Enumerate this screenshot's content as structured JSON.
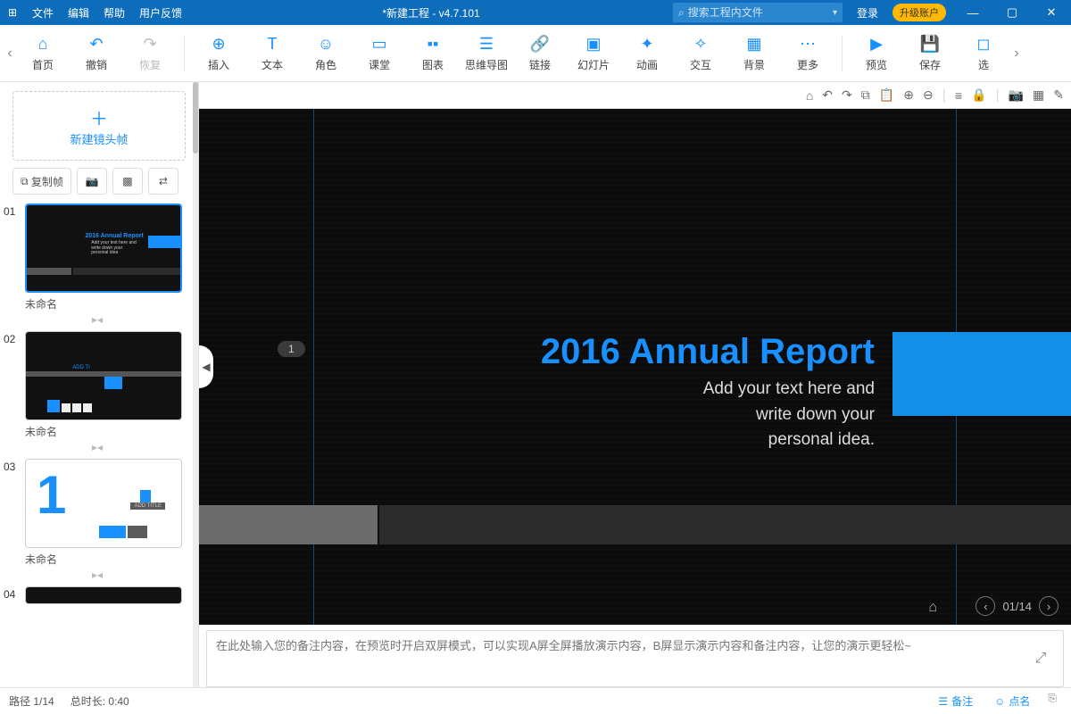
{
  "menu": {
    "file": "文件",
    "edit": "编辑",
    "help": "帮助",
    "feedback": "用户反馈"
  },
  "title": "*新建工程 - v4.7.101",
  "search": {
    "placeholder": "搜索工程内文件"
  },
  "auth": {
    "login": "登录",
    "upgrade": "升级账户"
  },
  "toolbar": {
    "home": "首页",
    "undo": "撤销",
    "redo": "恢复",
    "insert": "插入",
    "text": "文本",
    "role": "角色",
    "class": "课堂",
    "chart": "图表",
    "mindmap": "思维导图",
    "link": "链接",
    "slide": "幻灯片",
    "anim": "动画",
    "interact": "交互",
    "bg": "背景",
    "more": "更多",
    "preview": "预览",
    "save": "保存",
    "select": "选"
  },
  "sidebar": {
    "new_frame": "新建镜头帧",
    "copy_frame": "复制帧",
    "thumbs": [
      {
        "num": "01",
        "label": "未命名"
      },
      {
        "num": "02",
        "label": "未命名"
      },
      {
        "num": "03",
        "label": "未命名"
      },
      {
        "num": "04",
        "label": ""
      }
    ]
  },
  "slide": {
    "title": "2016 Annual Report",
    "subtitle": "Add your text here and\nwrite down your\npersonal idea.",
    "step": "1",
    "nav": "01/14"
  },
  "notes": {
    "placeholder": "在此处输入您的备注内容，在预览时开启双屏模式，可以实现A屏全屏播放演示内容，B屏显示演示内容和备注内容，让您的演示更轻松~"
  },
  "status": {
    "path": "路径 1/14",
    "duration": "总时长: 0:40",
    "notes": "备注",
    "roll": "点名"
  },
  "mini": {
    "add_title": "ADD TITLE",
    "slide2_title": "ADD TI"
  }
}
